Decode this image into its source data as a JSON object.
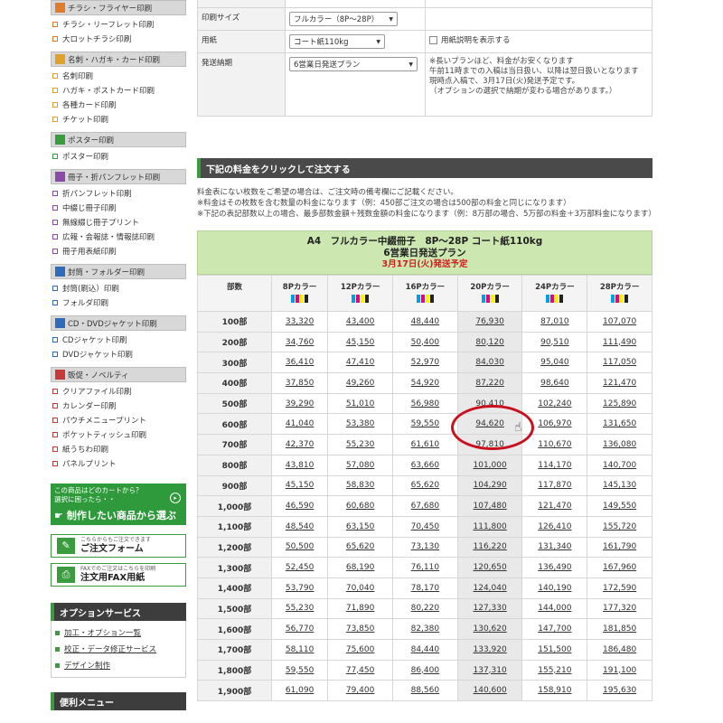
{
  "sidebar": {
    "categories": [
      {
        "title": "チラシ・フライヤー印刷",
        "color": "#e07b2b",
        "items": [
          "チラシ・リーフレット印刷",
          "大ロットチラシ印刷"
        ]
      },
      {
        "title": "名刺・ハガキ・カード印刷",
        "color": "#e0a12b",
        "items": [
          "名刺印刷",
          "ハガキ・ポストカード印刷",
          "各種カード印刷",
          "チケット印刷"
        ]
      },
      {
        "title": "ポスター印刷",
        "color": "#3a9b3f",
        "items": [
          "ポスター印刷"
        ]
      },
      {
        "title": "冊子・折パンフレット印刷",
        "color": "#8b4aa5",
        "items": [
          "折パンフレット印刷",
          "中綴じ冊子印刷",
          "無線綴じ冊子プリント",
          "広報・会報誌・情報誌印刷",
          "冊子用表紙印刷"
        ]
      },
      {
        "title": "封筒・フォルダー印刷",
        "color": "#2e6bb8",
        "items": [
          "封筒(刷込）印刷",
          "フォルダ印刷"
        ]
      },
      {
        "title": "CD・DVDジャケット印刷",
        "color": "#2e6bb8",
        "items": [
          "CDジャケット印刷",
          "DVDジャケット印刷"
        ]
      },
      {
        "title": "販促・ノベルティ",
        "color": "#c73a3a",
        "items": [
          "クリアファイル印刷",
          "カレンダー印刷",
          "パウチメニュープリント",
          "ポケットティッシュ印刷",
          "紙うちわ印刷",
          "パネルプリント"
        ]
      }
    ],
    "cta": {
      "line1": "この商品はどのカートから？",
      "line2": "選択に困ったら・・",
      "label": "制作したい商品から選ぶ"
    },
    "order_form": {
      "small": "こちらからもご注文できます",
      "label": "ご注文フォーム"
    },
    "fax_form": {
      "small": "FAXでのご注文はこちらを印刷",
      "label": "注文用FAX用紙"
    },
    "option_service": {
      "title": "オプションサービス",
      "links": [
        "加工・オプション一覧",
        "校正・データ修正サービス",
        "デザイン制作"
      ]
    },
    "convenience_menu": {
      "title": "便利メニュー"
    }
  },
  "options": {
    "rows": [
      {
        "label": "印刷サイズ",
        "value": "フルカラー（8P～28P）"
      },
      {
        "label": "用紙",
        "value": "コート紙110kg",
        "extra": "用紙説明を表示する"
      },
      {
        "label": "発送納期",
        "value": "6営業日発送プラン",
        "note": [
          "※長いプランほど、料金がお安くなります",
          "午前11時までの入稿は当日扱い、以降は翌日扱いとなります",
          "現時点入稿で、3月17日(火)発送予定です。",
          "（オプションの選択で納期が変わる場合があります。）"
        ]
      }
    ]
  },
  "section": {
    "title": "下記の料金をクリックして注文する",
    "notes": [
      "料金表にない枚数をご希望の場合は、ご注文時の備考欄にご記載ください。",
      "※料金はその枚数を含む数量の料金になります（例：450部ご注文の場合は500部の料金と同じになります）",
      "※下記の表記部数以上の場合、最多部数金額＋残数金額の料金になります（例：8万部の場合、5万部の料金＋3万部料金になります）"
    ]
  },
  "price_header": {
    "title": "A4　フルカラー中綴冊子　8P～28P コート紙110kg",
    "plan": "6営業日発送プラン",
    "date": "3月17日(火)発送予定"
  },
  "price_table": {
    "corner": "部数",
    "columns": [
      "8Pカラー",
      "12Pカラー",
      "16Pカラー",
      "20Pカラー",
      "24Pカラー",
      "28Pカラー"
    ],
    "rows": [
      {
        "qty": "100部",
        "prices": [
          "33,320",
          "43,400",
          "48,440",
          "76,930",
          "87,010",
          "107,070"
        ]
      },
      {
        "qty": "200部",
        "prices": [
          "34,760",
          "45,150",
          "50,400",
          "80,120",
          "90,510",
          "111,490"
        ]
      },
      {
        "qty": "300部",
        "prices": [
          "36,410",
          "47,410",
          "52,970",
          "84,030",
          "95,040",
          "117,050"
        ]
      },
      {
        "qty": "400部",
        "prices": [
          "37,850",
          "49,260",
          "54,920",
          "87,220",
          "98,640",
          "121,470"
        ]
      },
      {
        "qty": "500部",
        "prices": [
          "39,290",
          "51,010",
          "56,980",
          "90,410",
          "102,240",
          "125,890"
        ]
      },
      {
        "qty": "600部",
        "prices": [
          "41,040",
          "53,380",
          "59,550",
          "94,620",
          "106,970",
          "131,650"
        ]
      },
      {
        "qty": "700部",
        "prices": [
          "42,370",
          "55,230",
          "61,610",
          "97,810",
          "110,670",
          "136,080"
        ]
      },
      {
        "qty": "800部",
        "prices": [
          "43,810",
          "57,080",
          "63,660",
          "101,000",
          "114,170",
          "140,700"
        ]
      },
      {
        "qty": "900部",
        "prices": [
          "45,150",
          "58,830",
          "65,620",
          "104,290",
          "117,870",
          "145,130"
        ]
      },
      {
        "qty": "1,000部",
        "prices": [
          "46,590",
          "60,680",
          "67,680",
          "107,480",
          "121,470",
          "149,550"
        ]
      },
      {
        "qty": "1,100部",
        "prices": [
          "48,540",
          "63,150",
          "70,450",
          "111,800",
          "126,410",
          "155,720"
        ]
      },
      {
        "qty": "1,200部",
        "prices": [
          "50,500",
          "65,620",
          "73,130",
          "116,220",
          "131,340",
          "161,790"
        ]
      },
      {
        "qty": "1,300部",
        "prices": [
          "52,450",
          "68,190",
          "76,110",
          "120,650",
          "136,490",
          "167,960"
        ]
      },
      {
        "qty": "1,400部",
        "prices": [
          "53,790",
          "70,040",
          "78,170",
          "124,040",
          "140,190",
          "172,590"
        ]
      },
      {
        "qty": "1,500部",
        "prices": [
          "55,230",
          "71,890",
          "80,220",
          "127,330",
          "144,000",
          "177,320"
        ]
      },
      {
        "qty": "1,600部",
        "prices": [
          "56,770",
          "73,850",
          "82,380",
          "130,620",
          "147,700",
          "181,850"
        ]
      },
      {
        "qty": "1,700部",
        "prices": [
          "58,110",
          "75,600",
          "84,440",
          "133,920",
          "151,500",
          "186,480"
        ]
      },
      {
        "qty": "1,800部",
        "prices": [
          "59,550",
          "77,450",
          "86,400",
          "137,310",
          "155,210",
          "191,100"
        ]
      },
      {
        "qty": "1,900部",
        "prices": [
          "61,090",
          "79,400",
          "88,560",
          "140,600",
          "158,910",
          "195,630"
        ]
      }
    ]
  },
  "colors": {
    "accent": "#3a9b3f",
    "highlight_circle": "#c8101e",
    "header_bg": "#cde7b0",
    "date_red": "#d31d1d"
  }
}
